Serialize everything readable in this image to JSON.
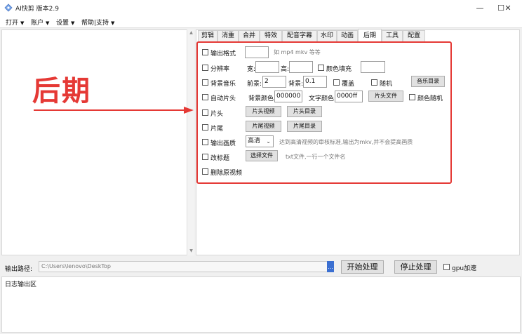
{
  "window": {
    "title": "AI快剪  版本2.9",
    "icon": "app-logo-icon",
    "controls": [
      "—",
      "☐",
      "✕"
    ]
  },
  "menu": [
    {
      "label": "打开"
    },
    {
      "label": "账户"
    },
    {
      "label": "设置"
    },
    {
      "label": "帮助|支持"
    }
  ],
  "tabs": [
    "剪辑",
    "消重",
    "合并",
    "特效",
    "配音字幕",
    "水印",
    "动画",
    "后期",
    "工具",
    "配置"
  ],
  "active_tab": "后期",
  "annotation": {
    "text": "后期",
    "color": "#e53935"
  },
  "rows": {
    "output_format": {
      "label": "输出格式",
      "value": "",
      "hint": "如 mp4 mkv 等等"
    },
    "resolution": {
      "label": "分辨率",
      "width_label": "宽:",
      "width_value": "",
      "height_label": "高:",
      "height_value": "",
      "fill_label": "颜色填充",
      "fill_value": ""
    },
    "bg_music": {
      "label": "背景音乐",
      "front_label": "前景:",
      "front_value": "2",
      "back_label": "背景:",
      "back_value": "0.1",
      "overlay_label": "覆盖",
      "random_label": "随机",
      "dir_button": "音乐目录"
    },
    "auto_intro": {
      "label": "自动片头",
      "bg_color_label": "背景颜色:",
      "bg_color_value": "000000",
      "text_color_label": "文字颜色:",
      "text_color_value": "0000ff",
      "file_button": "片头文件",
      "color_random_label": "颜色随机"
    },
    "intro": {
      "label": "片头",
      "video_button": "片头视频",
      "dir_button": "片头目录"
    },
    "outro": {
      "label": "片尾",
      "video_button": "片尾视频",
      "dir_button": "片尾目录"
    },
    "quality": {
      "label": "输出画质",
      "value": "高清",
      "hint": "达到高清视频的审核标准,输出为mkv,并不会提高画质"
    },
    "retitle": {
      "label": "改标题",
      "button": "选择文件",
      "hint": "txt文件,一行一个文件名"
    },
    "delete_source": {
      "label": "删除原视频"
    }
  },
  "bottom": {
    "path_label": "输出路径:",
    "path_value": "C:\\Users\\lenovo\\DeskTop",
    "browse_label": "...",
    "start_button": "开始处理",
    "stop_button": "停止处理",
    "gpu_label": "gpu加速"
  },
  "log": {
    "title": "日志输出区"
  },
  "colors": {
    "accent": "#e53935",
    "browse": "#3b6fd1"
  }
}
